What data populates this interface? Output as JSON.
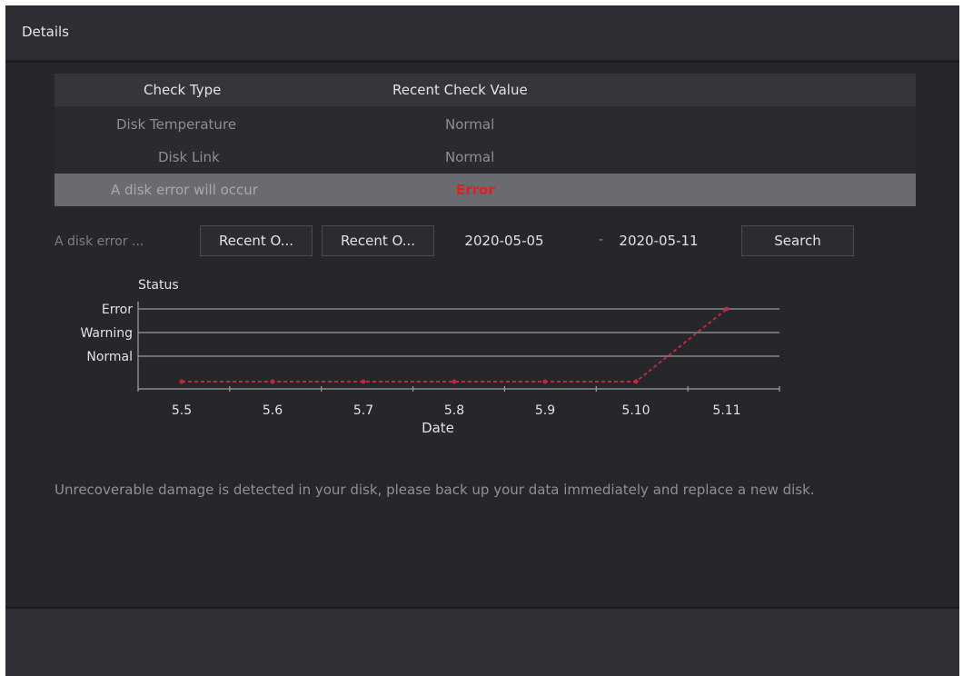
{
  "window": {
    "title": "Details"
  },
  "table": {
    "headers": [
      "Check Type",
      "Recent Check Value"
    ],
    "rows": [
      {
        "type": "Disk Temperature",
        "value": "Normal"
      },
      {
        "type": "Disk Link",
        "value": "Normal"
      },
      {
        "type": "A disk error will occur",
        "value": "Error"
      }
    ]
  },
  "filters": {
    "label": "A disk error ...",
    "recent_button_1": "Recent O...",
    "recent_button_2": "Recent O...",
    "start_date": "2020-05-05",
    "separator": "-",
    "end_date": "2020-05-11",
    "search_label": "Search"
  },
  "chart_data": {
    "type": "line",
    "title": "Status",
    "xlabel": "Date",
    "ylabel": "",
    "x": [
      "5.5",
      "5.6",
      "5.7",
      "5.8",
      "5.9",
      "5.10",
      "5.11"
    ],
    "y_categories": [
      "Normal",
      "Warning",
      "Error"
    ],
    "values": [
      "Normal",
      "Normal",
      "Normal",
      "Normal",
      "Normal",
      "Normal",
      "Error"
    ],
    "line_color": "#c0283a",
    "grid": true
  },
  "notice": "Unrecoverable damage is detected in your disk, please back up your data immediately and replace a new disk."
}
